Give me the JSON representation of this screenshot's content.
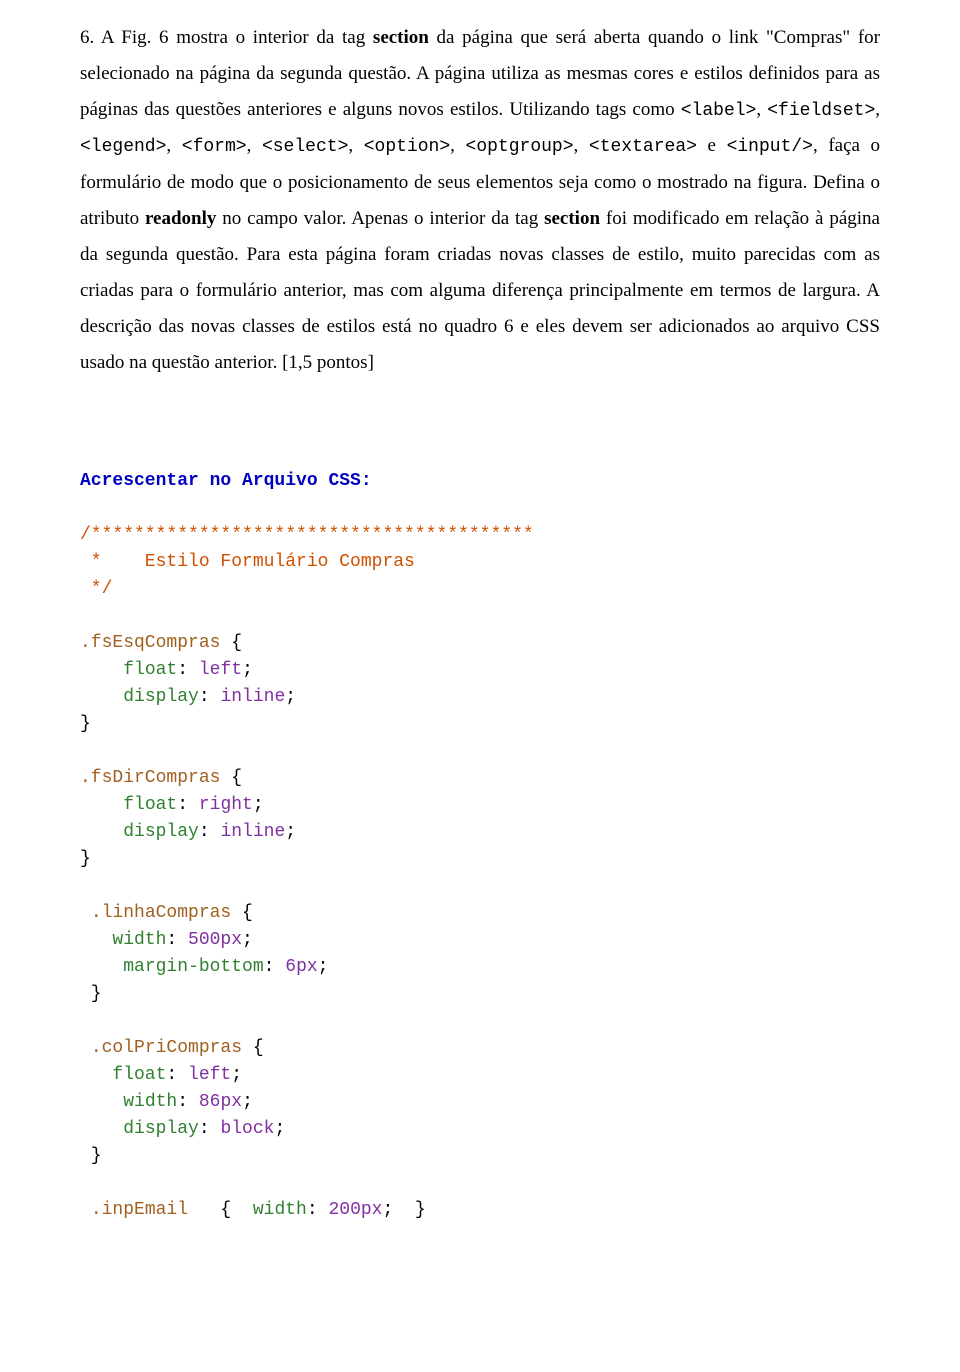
{
  "question": {
    "number": "6.",
    "text_parts": {
      "p1": "A Fig. 6 mostra o interior da tag ",
      "p2_bold": "section",
      "p3": " da página que será aberta quando o link \"Compras\" for selecionado na página da segunda questão. A página utiliza as mesmas cores e estilos definidos para as páginas das questões anteriores e alguns novos estilos. Utilizando tags como ",
      "c1": "<label>",
      "c2": "<fieldset>",
      "c3": "<legend>",
      "c4": "<form>",
      "c5": "<select>",
      "c6": "<option>",
      "c7": "<optgroup>",
      "c8": "<textarea>",
      "c9": "<input/>",
      "p4": ", faça o formulário de modo que o posicionamento de seus elementos seja como o mostrado na figura. Defina o atributo ",
      "p5_bold": "readonly",
      "p6": " no campo valor. Apenas o interior da tag ",
      "p7_bold": "section",
      "p8": " foi modificado em relação à página da segunda questão. Para esta página foram criadas novas classes de estilo, muito parecidas com as criadas para o formulário anterior, mas com alguma diferença principalmente em termos de largura. A descrição das novas classes de estilos está no quadro 6 e eles devem ser adicionados ao arquivo CSS usado na questão anterior. [1,5 pontos]"
    }
  },
  "css_heading": "Acrescentar no Arquivo CSS:",
  "css_comment": {
    "line1": "/*****************************************",
    "line2": " *    Estilo Formulário Compras",
    "line3": " */"
  },
  "rules": [
    {
      "selector": ".fsEsqCompras",
      "props": [
        {
          "prop": "float",
          "val": "left"
        },
        {
          "prop": "display",
          "val": "inline"
        }
      ]
    },
    {
      "selector": ".fsDirCompras",
      "props": [
        {
          "prop": "float",
          "val": "right"
        },
        {
          "prop": "display",
          "val": "inline"
        }
      ]
    },
    {
      "selector": ".linhaCompras",
      "props": [
        {
          "prop": "width",
          "val": "500px"
        },
        {
          "prop": "margin-bottom",
          "val": "6px"
        }
      ]
    },
    {
      "selector": ".colPriCompras",
      "props": [
        {
          "prop": "float",
          "val": "left"
        },
        {
          "prop": "width",
          "val": "86px"
        },
        {
          "prop": "display",
          "val": "block"
        }
      ]
    }
  ],
  "inline_rule": {
    "selector": ".inpEmail",
    "prop": "width",
    "val": "200px"
  }
}
